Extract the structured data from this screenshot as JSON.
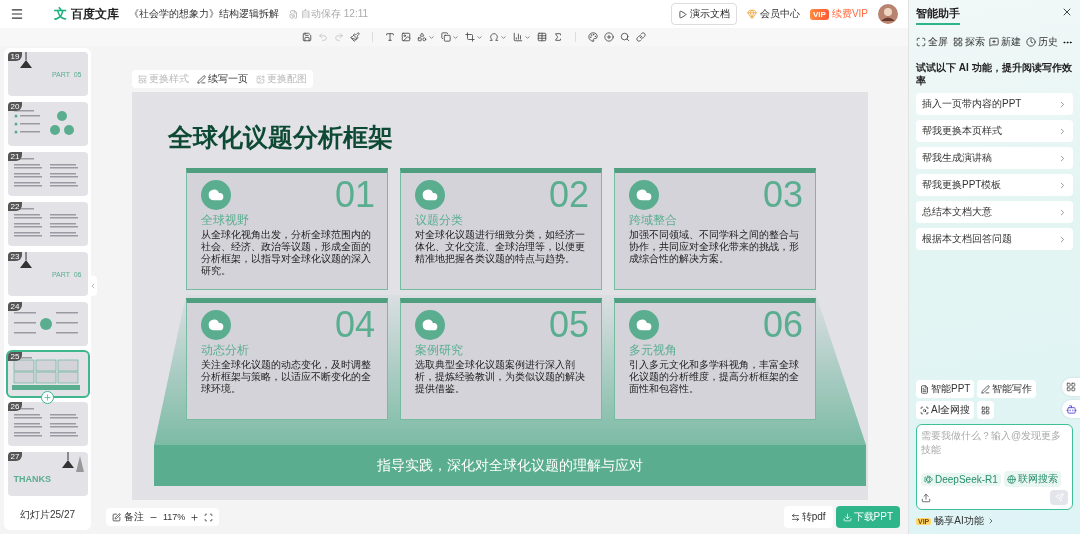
{
  "topbar": {
    "logo_mark": "文",
    "app_name": "百度文库",
    "doc_title": "《社会学的想象力》结构逻辑拆解",
    "autosave": "自动保存 12:11",
    "present": "演示文档",
    "member_center": "会员中心",
    "vip_badge": "VIP",
    "vip": "续费VIP"
  },
  "toolbar": [
    [
      {
        "kind": "save",
        "disabled": false,
        "dropdown": false
      },
      {
        "kind": "undo",
        "disabled": true,
        "dropdown": false
      },
      {
        "kind": "redo",
        "disabled": true,
        "dropdown": false
      },
      {
        "kind": "brush",
        "disabled": false,
        "dropdown": false
      }
    ],
    [
      {
        "kind": "text",
        "disabled": false,
        "dropdown": false
      },
      {
        "kind": "image",
        "disabled": false,
        "dropdown": false
      },
      {
        "kind": "shape",
        "disabled": false,
        "dropdown": true
      },
      {
        "kind": "copy",
        "disabled": false,
        "dropdown": true
      },
      {
        "kind": "crop",
        "disabled": false,
        "dropdown": true
      },
      {
        "kind": "symbol",
        "disabled": false,
        "dropdown": true
      },
      {
        "kind": "chart",
        "disabled": false,
        "dropdown": true
      },
      {
        "kind": "table",
        "disabled": false,
        "dropdown": false
      },
      {
        "kind": "formula",
        "disabled": false,
        "dropdown": false
      }
    ],
    [
      {
        "kind": "palette",
        "disabled": false,
        "dropdown": false
      },
      {
        "kind": "add",
        "disabled": false,
        "dropdown": false
      },
      {
        "kind": "search",
        "disabled": false,
        "dropdown": false
      },
      {
        "kind": "link",
        "disabled": false,
        "dropdown": false
      }
    ]
  ],
  "slide_actions": [
    {
      "kind": "style",
      "label": "更换样式",
      "disabled": true
    },
    {
      "kind": "write",
      "label": "续写一页",
      "disabled": false
    },
    {
      "kind": "image",
      "label": "更换配图",
      "disabled": true
    }
  ],
  "thumbnails": [
    {
      "number": "19",
      "kind": "section",
      "label": "PART  05",
      "selected": false
    },
    {
      "number": "20",
      "kind": "diagram",
      "selected": false
    },
    {
      "number": "21",
      "kind": "list",
      "selected": false
    },
    {
      "number": "22",
      "kind": "list",
      "selected": false
    },
    {
      "number": "23",
      "kind": "section",
      "label": "PART  06",
      "selected": false
    },
    {
      "number": "24",
      "kind": "hub",
      "selected": false
    },
    {
      "number": "25",
      "kind": "grid",
      "selected": true
    },
    {
      "number": "26",
      "kind": "list",
      "selected": false
    },
    {
      "number": "27",
      "kind": "thanks",
      "label": "THANKS",
      "selected": false
    }
  ],
  "slide_counter": "幻灯片25/27",
  "slide": {
    "title": "全球化议题分析框架",
    "cards": [
      {
        "number": "01",
        "heading": "全球视野",
        "body": "从全球化视角出发，分析全球范围内的社会、经济、政治等议题，形成全面的分析框架，以指导对全球化议题的深入研究。"
      },
      {
        "number": "02",
        "heading": "议题分类",
        "body": "对全球化议题进行细致分类，如经济一体化、文化交流、全球治理等，以便更精准地把握各类议题的特点与趋势。"
      },
      {
        "number": "03",
        "heading": "跨域整合",
        "body": "加强不同领域、不同学科之间的整合与协作，共同应对全球化带来的挑战，形成综合性的解决方案。"
      },
      {
        "number": "04",
        "heading": "动态分析",
        "body": "关注全球化议题的动态变化，及时调整分析框架与策略，以适应不断变化的全球环境。"
      },
      {
        "number": "05",
        "heading": "案例研究",
        "body": "选取典型全球化议题案例进行深入剖析，提炼经验教训，为类似议题的解决提供借鉴。"
      },
      {
        "number": "06",
        "heading": "多元视角",
        "body": "引入多元文化和多学科视角，丰富全球化议题的分析维度，提高分析框架的全面性和包容性。"
      }
    ],
    "footer": "指导实践，深化对全球化议题的理解与应对"
  },
  "bottom_bar": {
    "notes": "备注",
    "zoom": "117%",
    "to_pdf": "转pdf",
    "download": "下载PPT"
  },
  "assistant": {
    "title": "智能助手",
    "actions": [
      {
        "kind": "fullscreen",
        "label": "全屏"
      },
      {
        "kind": "explore",
        "label": "探索"
      },
      {
        "kind": "new",
        "label": "新建"
      },
      {
        "kind": "history",
        "label": "历史"
      }
    ],
    "prompt_heading": "试试以下 AI 功能，提升阅读写作效率",
    "suggestions": [
      "插入一页带内容的PPT",
      "帮我更换本页样式",
      "帮我生成演讲稿",
      "帮我更换PPT模板",
      "总结本文档大意",
      "根据本文档回答问题"
    ],
    "tools": [
      {
        "kind": "ppt",
        "label": "智能PPT"
      },
      {
        "kind": "write",
        "label": "智能写作"
      },
      {
        "kind": "search",
        "label": "AI全网搜"
      }
    ],
    "input_placeholder": "需要我做什么？输入@发现更多技能",
    "model": "DeepSeek-R1",
    "web_search": "联网搜索",
    "vip_badge": "VIP",
    "vip_note": "畅享AI功能"
  }
}
